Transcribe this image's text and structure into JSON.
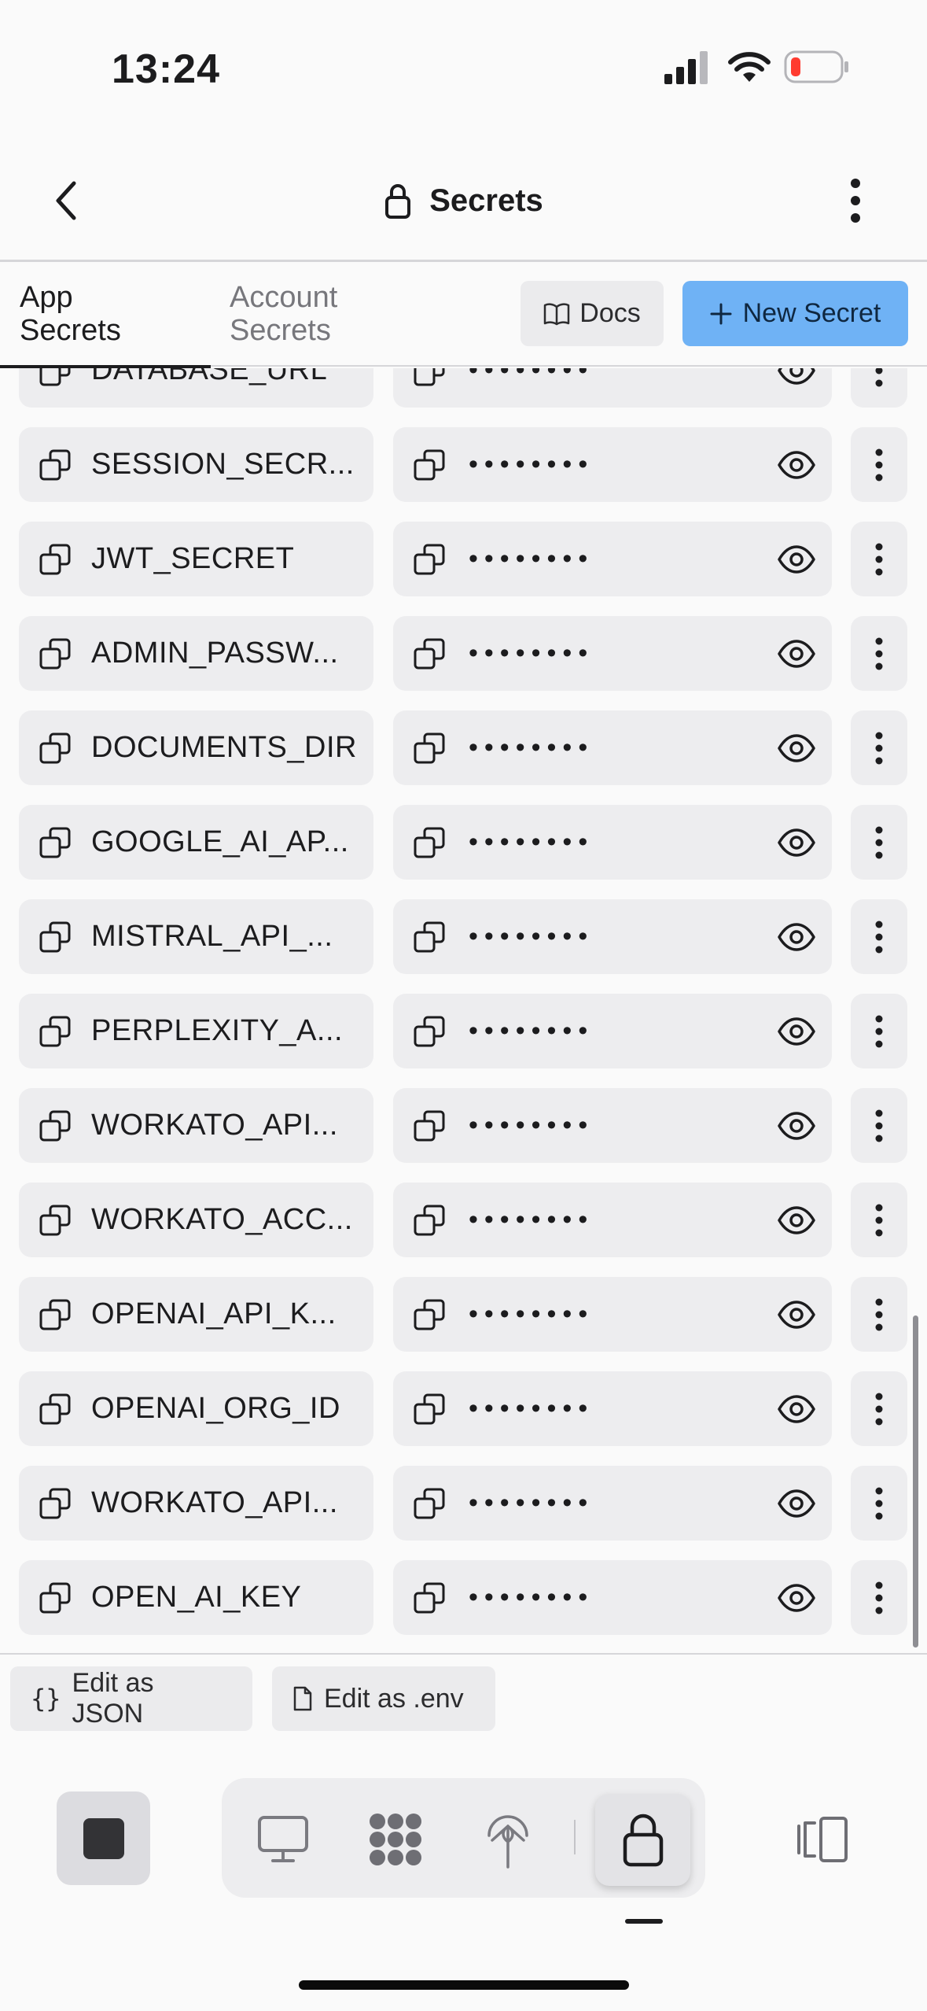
{
  "status_bar": {
    "time": "13:24"
  },
  "header": {
    "title": "Secrets"
  },
  "tabs": {
    "app": "App\nSecrets",
    "account": "Account\nSecrets"
  },
  "toolbar": {
    "docs_label": "Docs",
    "new_secret_label": "New Secret"
  },
  "secrets": [
    {
      "key": "DATABASE_URL",
      "masked": "••••••••"
    },
    {
      "key": "SESSION_SECR...",
      "masked": "••••••••"
    },
    {
      "key": "JWT_SECRET",
      "masked": "••••••••"
    },
    {
      "key": "ADMIN_PASSW...",
      "masked": "••••••••"
    },
    {
      "key": "DOCUMENTS_DIR",
      "masked": "••••••••"
    },
    {
      "key": "GOOGLE_AI_AP...",
      "masked": "••••••••"
    },
    {
      "key": "MISTRAL_API_...",
      "masked": "••••••••"
    },
    {
      "key": "PERPLEXITY_A...",
      "masked": "••••••••"
    },
    {
      "key": "WORKATO_API...",
      "masked": "••••••••"
    },
    {
      "key": "WORKATO_ACC...",
      "masked": "••••••••"
    },
    {
      "key": "OPENAI_API_K...",
      "masked": "••••••••"
    },
    {
      "key": "OPENAI_ORG_ID",
      "masked": "••••••••"
    },
    {
      "key": "WORKATO_API...",
      "masked": "••••••••"
    },
    {
      "key": "OPEN_AI_KEY",
      "masked": "••••••••"
    }
  ],
  "footer": {
    "edit_json_label": "Edit as JSON",
    "edit_env_label": "Edit as .env"
  },
  "colors": {
    "accent": "#6fb2f5",
    "cell_bg": "#ededef",
    "battery_low": "#ff3b30"
  }
}
